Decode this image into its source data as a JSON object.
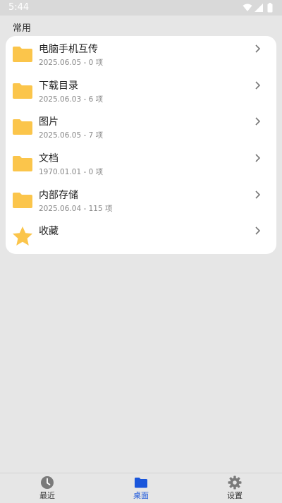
{
  "status_bar": {
    "time": "5:44"
  },
  "section": {
    "title": "常用"
  },
  "items": [
    {
      "title": "电脑手机互传",
      "subtitle": "2025.06.05 - 0 项",
      "icon": "folder-icon"
    },
    {
      "title": "下载目录",
      "subtitle": "2025.06.03 - 6 项",
      "icon": "folder-icon"
    },
    {
      "title": "图片",
      "subtitle": "2025.06.05 - 7 项",
      "icon": "folder-icon"
    },
    {
      "title": "文档",
      "subtitle": "1970.01.01 - 0 项",
      "icon": "folder-icon"
    },
    {
      "title": "内部存储",
      "subtitle": "2025.06.04 - 115 项",
      "icon": "folder-icon"
    },
    {
      "title": "收藏",
      "subtitle": "",
      "icon": "star-icon"
    }
  ],
  "bottom_nav": [
    {
      "label": "最近",
      "icon": "clock-icon",
      "active": false
    },
    {
      "label": "桌面",
      "icon": "folder-icon",
      "active": true
    },
    {
      "label": "设置",
      "icon": "gear-icon",
      "active": false
    }
  ],
  "colors": {
    "folder": "#fbc54b",
    "accent": "#1a56db",
    "background": "#e6e6e6"
  }
}
